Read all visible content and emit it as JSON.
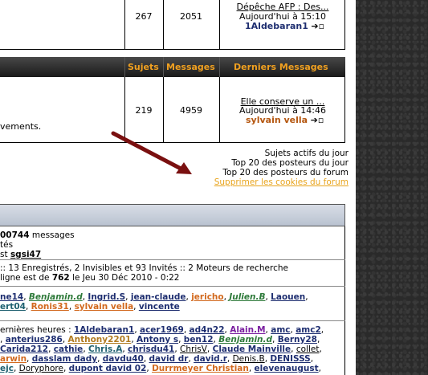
{
  "forum_top_row": {
    "sujets": "267",
    "messages": "2051",
    "last_title": "Dépêche AFP : Des...",
    "last_date": "Aujourd'hui à 15:10",
    "last_user": "1Aldebaran1"
  },
  "header": {
    "sujets": "Sujets",
    "messages": "Messages",
    "derniers": "Derniers Messages"
  },
  "forum_row2": {
    "desc_tail": "vements.",
    "sujets": "219",
    "messages": "4959",
    "last_title": "Elle conserve un ...",
    "last_date": "Aujourd'hui à 14:46",
    "last_user": "sylvain vella"
  },
  "links": {
    "sujets_actifs": "Sujets actifs du jour",
    "top20_jour": "Top 20 des posteurs du jour",
    "top20_forum": "Top 20 des posteurs du forum",
    "cookies": "Supprimer les cookies du forum"
  },
  "stats": {
    "messages_count": "00744",
    "messages_label": "messages",
    "line2": "tés",
    "line3_prefix": "st",
    "line3_user": "sgsi47"
  },
  "online": {
    "line1": ":: 13 Enregistrés, 2 Invisibles et 93 Invités :: 2 Moteurs de recherche",
    "line2_prefix": "ligne est de",
    "line2_count": "762",
    "line2_suffix": "le Jeu 30 Déc 2010 - 0:22"
  },
  "users_online": {
    "row1": [
      "ne14",
      "Benjamin.d",
      "Ingrid.S",
      "jean-claude",
      "jericho",
      "Julien.B",
      "Laouen"
    ],
    "row2": [
      "ert04",
      "Ronis31",
      "sylvain vella",
      "vincente"
    ]
  },
  "last_hours": {
    "label": "ernières heures :",
    "row1": [
      "1Aldebaran1",
      "acer1969",
      "ad4n22",
      "Alain.M",
      "amc",
      "amc2"
    ],
    "row2": [
      "anterius286",
      "Anthony2201",
      "Antony s",
      "ben12",
      "Benjamin.d",
      "Berny28"
    ],
    "row3": [
      "Carida212",
      "cathie",
      "Chris.A",
      "chrisdu41",
      "ChrisV",
      "Claude Mainville",
      "collet"
    ],
    "row4": [
      "arwin",
      "dasslam dady",
      "davdu40",
      "david dr",
      "david.r",
      "Denis.B",
      "DENISSS"
    ],
    "row5": [
      "ejc",
      "Doryphore",
      "dupont david 02",
      "Durrmeyer Christian",
      "elevenaugust"
    ]
  }
}
